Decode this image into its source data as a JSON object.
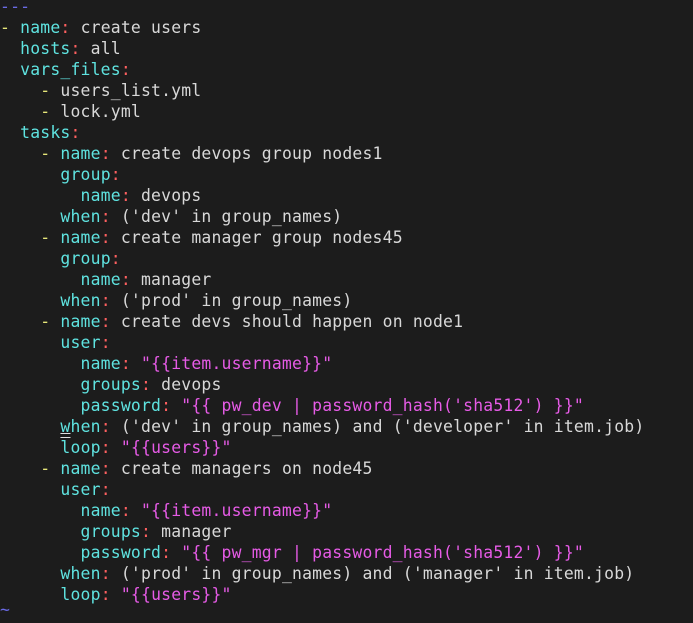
{
  "editor": {
    "doc_start": "---",
    "tilde": "~",
    "lines": [
      {
        "indent": "",
        "dash": "- ",
        "key": "name",
        "value": "create users",
        "value_type": "plain"
      },
      {
        "indent": "  ",
        "dash": "",
        "key": "hosts",
        "value": "all",
        "value_type": "plain"
      },
      {
        "indent": "  ",
        "dash": "",
        "key": "vars_files",
        "value": "",
        "value_type": "plain"
      },
      {
        "indent": "    ",
        "dash": "- ",
        "key": "",
        "value": "users_list.yml",
        "value_type": "plain"
      },
      {
        "indent": "    ",
        "dash": "- ",
        "key": "",
        "value": "lock.yml",
        "value_type": "plain"
      },
      {
        "indent": "  ",
        "dash": "",
        "key": "tasks",
        "value": "",
        "value_type": "plain"
      },
      {
        "indent": "    ",
        "dash": "- ",
        "key": "name",
        "value": "create devops group nodes1",
        "value_type": "plain"
      },
      {
        "indent": "      ",
        "dash": "",
        "key": "group",
        "value": "",
        "value_type": "plain"
      },
      {
        "indent": "        ",
        "dash": "",
        "key": "name",
        "value": "devops",
        "value_type": "plain"
      },
      {
        "indent": "      ",
        "dash": "",
        "key": "when",
        "value": "('dev' in group_names)",
        "value_type": "plain"
      },
      {
        "indent": "    ",
        "dash": "- ",
        "key": "name",
        "value": "create manager group nodes45",
        "value_type": "plain"
      },
      {
        "indent": "      ",
        "dash": "",
        "key": "group",
        "value": "",
        "value_type": "plain"
      },
      {
        "indent": "        ",
        "dash": "",
        "key": "name",
        "value": "manager",
        "value_type": "plain"
      },
      {
        "indent": "      ",
        "dash": "",
        "key": "when",
        "value": "('prod' in group_names)",
        "value_type": "plain"
      },
      {
        "indent": "    ",
        "dash": "- ",
        "key": "name",
        "value": "create devs should happen on node1",
        "value_type": "plain"
      },
      {
        "indent": "      ",
        "dash": "",
        "key": "user",
        "value": "",
        "value_type": "plain"
      },
      {
        "indent": "        ",
        "dash": "",
        "key": "name",
        "value": "\"{{item.username}}\"",
        "value_type": "string"
      },
      {
        "indent": "        ",
        "dash": "",
        "key": "groups",
        "value": "devops",
        "value_type": "plain"
      },
      {
        "indent": "        ",
        "dash": "",
        "key": "password",
        "value": "\"{{ pw_dev | password_hash('sha512') }}\"",
        "value_type": "string"
      },
      {
        "indent": "      ",
        "dash": "",
        "key": "when",
        "value": "('dev' in group_names) and ('developer' in item.job)",
        "value_type": "plain",
        "cursor": "under-w"
      },
      {
        "indent": "      ",
        "dash": "",
        "key": "loop",
        "value": "\"{{users}}\"",
        "value_type": "string",
        "cursor": "over-l"
      },
      {
        "indent": "    ",
        "dash": "- ",
        "key": "name",
        "value": "create managers on node45",
        "value_type": "plain"
      },
      {
        "indent": "      ",
        "dash": "",
        "key": "user",
        "value": "",
        "value_type": "plain"
      },
      {
        "indent": "        ",
        "dash": "",
        "key": "name",
        "value": "\"{{item.username}}\"",
        "value_type": "string"
      },
      {
        "indent": "        ",
        "dash": "",
        "key": "groups",
        "value": "manager",
        "value_type": "plain"
      },
      {
        "indent": "        ",
        "dash": "",
        "key": "password",
        "value": "\"{{ pw_mgr | password_hash('sha512') }}\"",
        "value_type": "string"
      },
      {
        "indent": "      ",
        "dash": "",
        "key": "when",
        "value": "('prod' in group_names) and ('manager' in item.job)",
        "value_type": "plain"
      },
      {
        "indent": "      ",
        "dash": "",
        "key": "loop",
        "value": "\"{{users}}\"",
        "value_type": "string"
      }
    ]
  },
  "colors": {
    "background": "#1c1c1c",
    "key": "#5fe3e0",
    "colon": "#ff6060",
    "dash": "#e7e77a",
    "string": "#e65be6",
    "text": "#d8d8d8",
    "marker": "#6a6ae6"
  }
}
